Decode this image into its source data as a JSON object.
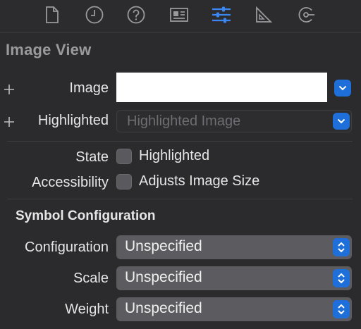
{
  "toolbar": {
    "tabs": [
      {
        "icon": "file-icon"
      },
      {
        "icon": "clock-icon"
      },
      {
        "icon": "help-icon"
      },
      {
        "icon": "identity-card-icon"
      },
      {
        "icon": "sliders-icon",
        "selected": true
      },
      {
        "icon": "ruler-icon"
      },
      {
        "icon": "connections-icon"
      }
    ],
    "accent": "#3a86f5"
  },
  "section": {
    "title": "Image View"
  },
  "fields": {
    "image_label": "Image",
    "image_value": "",
    "highlighted_label": "Highlighted",
    "highlighted_placeholder": "Highlighted Image",
    "state_label": "State",
    "state_checkbox": "Highlighted",
    "accessibility_label": "Accessibility",
    "accessibility_checkbox": "Adjusts Image Size"
  },
  "symbol": {
    "title": "Symbol Configuration",
    "rows": [
      {
        "label": "Configuration",
        "value": "Unspecified"
      },
      {
        "label": "Scale",
        "value": "Unspecified"
      },
      {
        "label": "Weight",
        "value": "Unspecified"
      }
    ]
  }
}
